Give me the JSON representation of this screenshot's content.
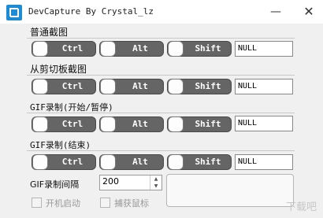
{
  "window": {
    "title": "DevCapture By Crystal_lz",
    "minimize_glyph": "—",
    "close_glyph": "✕"
  },
  "sections": [
    {
      "label": "普通截图",
      "toggles": [
        {
          "label": "Ctrl",
          "on": true
        },
        {
          "label": "Alt",
          "on": true
        },
        {
          "label": "Shift",
          "on": false
        }
      ],
      "field_value": "NULL"
    },
    {
      "label": "从剪切板截图",
      "toggles": [
        {
          "label": "Ctrl",
          "on": true
        },
        {
          "label": "Alt",
          "on": true
        },
        {
          "label": "Shift",
          "on": false
        }
      ],
      "field_value": "NULL"
    },
    {
      "label": "GIF录制(开始/暂停)",
      "toggles": [
        {
          "label": "Ctrl",
          "on": true
        },
        {
          "label": "Alt",
          "on": true
        },
        {
          "label": "Shift",
          "on": false
        }
      ],
      "field_value": "NULL"
    },
    {
      "label": "GIF录制(结束)",
      "toggles": [
        {
          "label": "Ctrl",
          "on": true
        },
        {
          "label": "Alt",
          "on": true
        },
        {
          "label": "Shift",
          "on": false
        }
      ],
      "field_value": "NULL"
    }
  ],
  "interval": {
    "label": "GIF录制间隔",
    "value": "200"
  },
  "options": {
    "autostart_label": "开机启动",
    "capture_cursor_label": "捕获鼠标"
  },
  "watermark": "下载吧",
  "colors": {
    "toggle_on": "#656565",
    "app_icon": "#1e8bd6"
  }
}
